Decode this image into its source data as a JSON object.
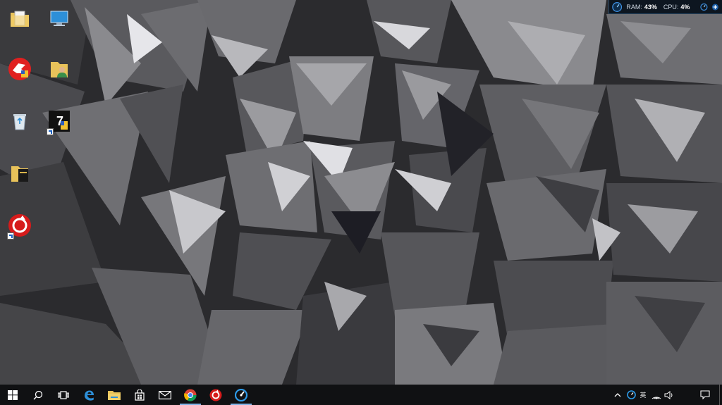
{
  "system_monitor": {
    "ram_label": "RAM:",
    "ram_value": "43%",
    "cpu_label": "CPU:",
    "cpu_value": "4%"
  },
  "desktop_icons": [
    {
      "name": "folder-document-icon"
    },
    {
      "name": "this-pc-icon"
    },
    {
      "name": "red-dragon-app-icon"
    },
    {
      "name": "user-folder-icon"
    },
    {
      "name": "recycle-bin-icon"
    },
    {
      "name": "7-zip-shortcut-icon"
    },
    {
      "name": "folder-book-icon"
    },
    {
      "name": "driver-booster-shortcut-icon"
    }
  ],
  "taskbar": {
    "buttons": [
      "start",
      "search",
      "task-view",
      "edge",
      "file-explorer",
      "store",
      "mail",
      "chrome",
      "driver-booster",
      "advanced-systemcare"
    ],
    "tray": {
      "ime_text": "英"
    }
  },
  "colors": {
    "taskbar": "#101113",
    "accent": "#7fb2e6",
    "monitor_bg": "#0d1620"
  }
}
